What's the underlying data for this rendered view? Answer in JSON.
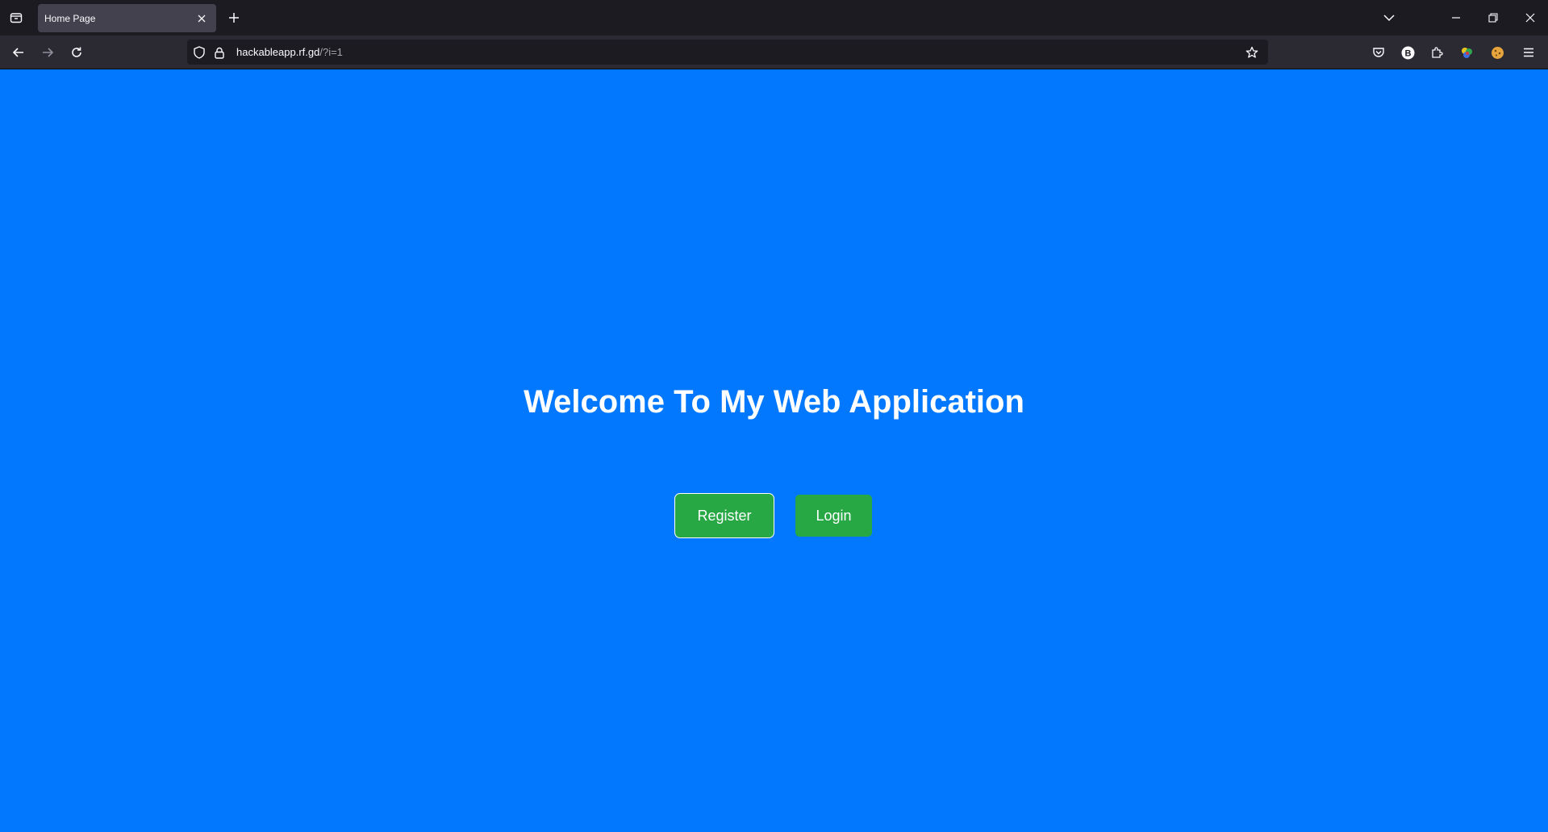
{
  "browser": {
    "tab": {
      "title": "Home Page"
    },
    "url": {
      "host": "hackableapp.rf.gd",
      "path": "/?i=1"
    },
    "extension_badge": "B"
  },
  "page": {
    "heading": "Welcome To My Web Application",
    "buttons": {
      "register": "Register",
      "login": "Login"
    },
    "colors": {
      "background": "#0178fe",
      "button": "#27a844",
      "text": "#ffffff"
    }
  }
}
